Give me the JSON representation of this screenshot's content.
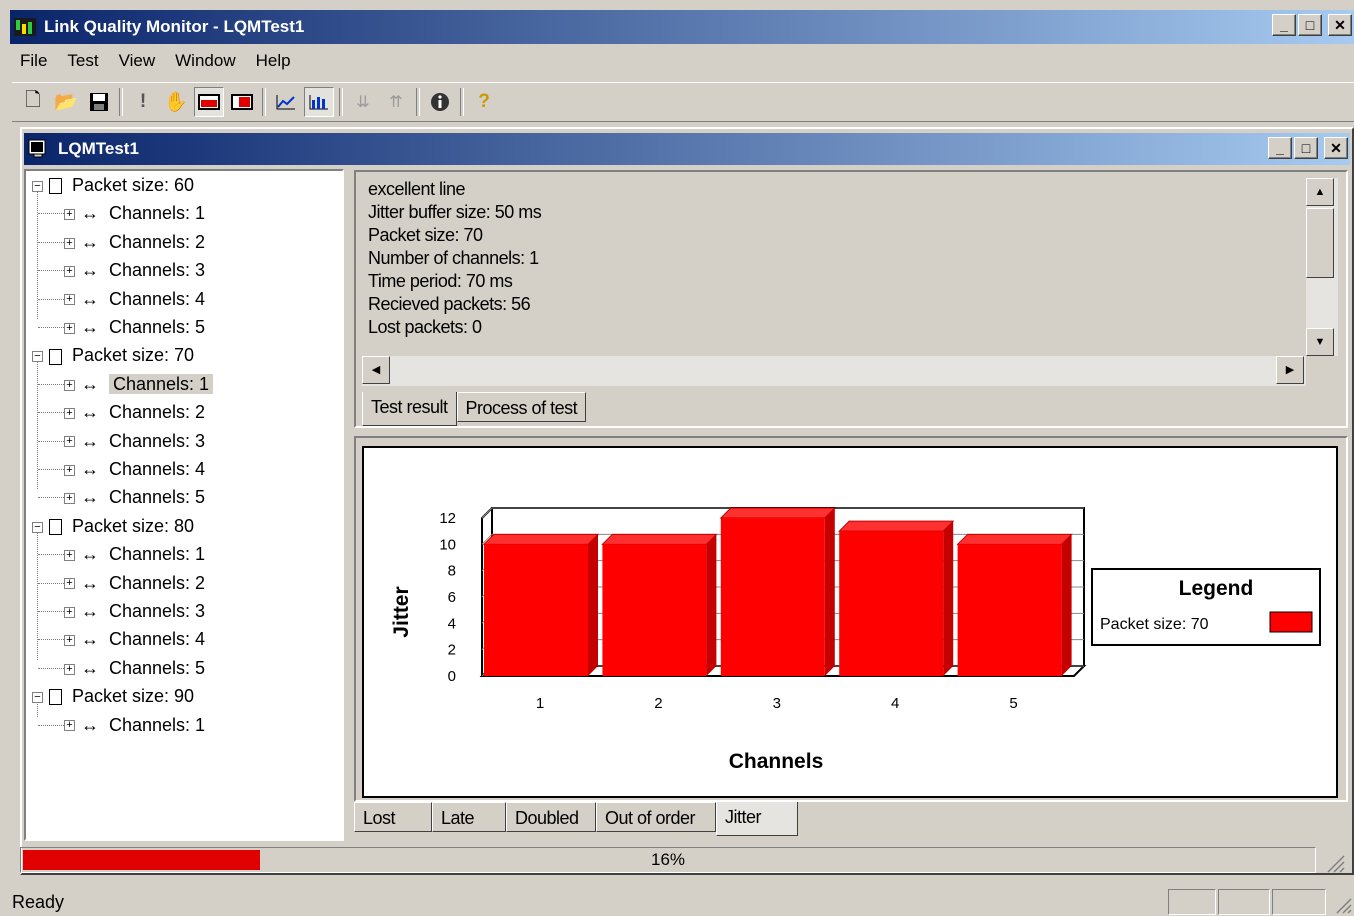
{
  "app": {
    "title": "Link Quality Monitor - LQMTest1"
  },
  "menu": [
    "File",
    "Test",
    "View",
    "Window",
    "Help"
  ],
  "toolbar": {
    "icons": [
      "new-icon",
      "open-icon",
      "save-icon",
      "run-icon",
      "stop-hand-icon",
      "layout-left-icon",
      "layout-right-icon",
      "line-chart-icon",
      "bar-chart-icon",
      "sort-down-icon",
      "sort-up-icon",
      "info-icon",
      "help-icon"
    ]
  },
  "document": {
    "title": "LQMTest1"
  },
  "tree": [
    {
      "label": "Packet size: 60",
      "children": [
        "Channels: 1",
        "Channels: 2",
        "Channels: 3",
        "Channels: 4",
        "Channels: 5"
      ]
    },
    {
      "label": "Packet size: 70",
      "children": [
        "Channels: 1",
        "Channels: 2",
        "Channels: 3",
        "Channels: 4",
        "Channels: 5"
      ]
    },
    {
      "label": "Packet size: 80",
      "children": [
        "Channels: 1",
        "Channels: 2",
        "Channels: 3",
        "Channels: 4",
        "Channels: 5"
      ]
    },
    {
      "label": "Packet size: 90",
      "children": [
        "Channels: 1"
      ]
    }
  ],
  "selected_node": "Packet size: 70 / Channels: 1",
  "result": {
    "lines": [
      "excellent line",
      "Jitter buffer size: 50 ms",
      "Packet size: 70",
      "Number of channels: 1",
      "Time period: 70 ms",
      "Recieved packets: 56",
      "Lost packets: 0"
    ],
    "tabs": [
      "Test result",
      "Process of test"
    ],
    "active_tab": "Test result"
  },
  "chart_tabs": [
    "Lost",
    "Late",
    "Doubled",
    "Out of order",
    "Jitter"
  ],
  "active_chart_tab": "Jitter",
  "chart_data": {
    "type": "bar",
    "categories": [
      "1",
      "2",
      "3",
      "4",
      "5"
    ],
    "series": [
      {
        "name": "Packet size: 70",
        "values": [
          10,
          10,
          12,
          11,
          10
        ],
        "color": "#ff0000"
      }
    ],
    "xlabel": "Channels",
    "ylabel": "Jitter",
    "ylim": [
      0,
      12
    ],
    "yticks": [
      0,
      2,
      4,
      6,
      8,
      10,
      12
    ],
    "grid": true,
    "legend_title": "Legend",
    "legend_position": "right"
  },
  "progress": {
    "value": 0.16,
    "label": "16%",
    "color": "#e00000"
  },
  "status": {
    "text": "Ready"
  }
}
